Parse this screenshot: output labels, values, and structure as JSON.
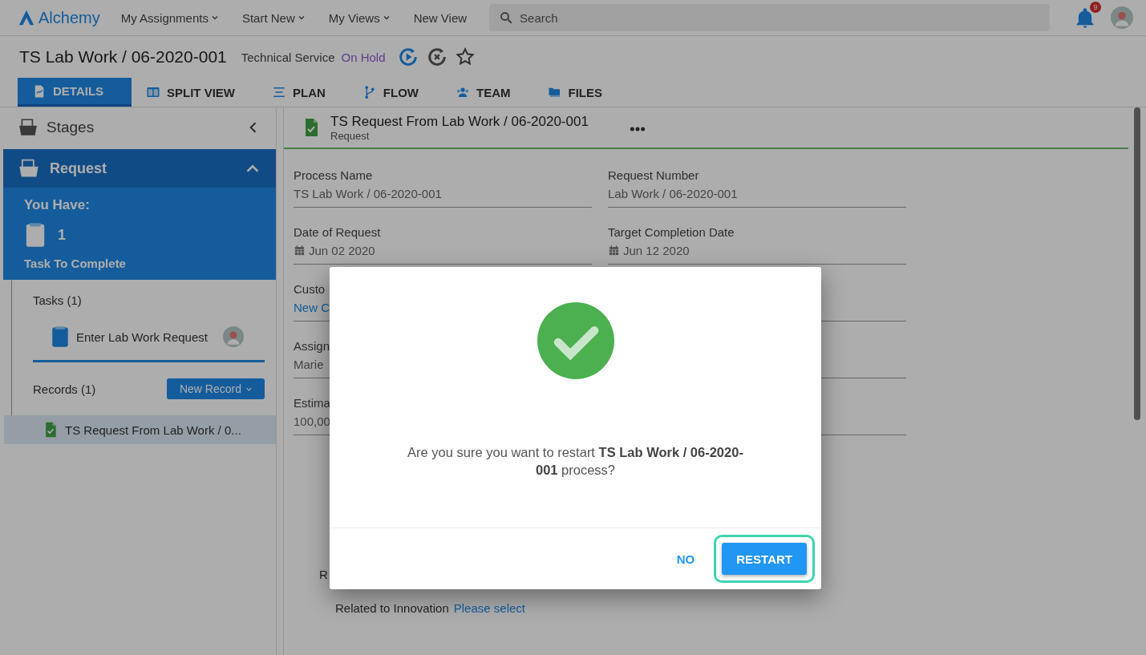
{
  "topbar": {
    "logo": "Alchemy",
    "nav": [
      {
        "label": "My Assignments",
        "dropdown": true
      },
      {
        "label": "Start New",
        "dropdown": true
      },
      {
        "label": "My Views",
        "dropdown": true
      },
      {
        "label": "New View",
        "dropdown": false
      }
    ],
    "search": {
      "placeholder": "Search"
    },
    "notifications": "9"
  },
  "header": {
    "title": "TS Lab Work / 06-2020-001",
    "type": "Technical Service",
    "status": "On Hold"
  },
  "tabs": [
    {
      "label": "DETAILS",
      "selected": true
    },
    {
      "label": "SPLIT VIEW",
      "selected": false
    },
    {
      "label": "PLAN",
      "selected": false
    },
    {
      "label": "FLOW",
      "selected": false
    },
    {
      "label": "TEAM",
      "selected": false
    },
    {
      "label": "FILES",
      "selected": false
    }
  ],
  "sidebar": {
    "heading": "Stages",
    "stage": {
      "name": "Request",
      "expanded": true
    },
    "summary": {
      "heading": "You Have:",
      "count": "1",
      "caption": "Task To Complete"
    },
    "tasks": {
      "heading": "Tasks (1)",
      "items": [
        {
          "label": "Enter Lab Work Request"
        }
      ]
    },
    "records": {
      "heading": "Records (1)",
      "button": "New Record",
      "items": [
        {
          "label": "TS Request From Lab Work / 0...",
          "selected": true
        }
      ]
    }
  },
  "record": {
    "title": "TS Request From Lab Work / 06-2020-001",
    "subtitle": "Request",
    "fields": [
      {
        "label": "Process Name",
        "value": "TS Lab Work / 06-2020-001",
        "kind": "text"
      },
      {
        "label": "Request Number",
        "value": "Lab Work / 06-2020-001",
        "kind": "text"
      },
      {
        "label": "Date of Request",
        "value": "Jun 02 2020",
        "kind": "date"
      },
      {
        "label": "Target Completion Date",
        "value": "Jun 12 2020",
        "kind": "date"
      },
      {
        "label": "Custo",
        "value": "New C",
        "kind": "link"
      },
      {
        "kind": "hidden"
      },
      {
        "label": "Assign",
        "value": "Marie",
        "kind": "text"
      },
      {
        "kind": "hidden"
      },
      {
        "label": "Estima",
        "value": "100,00",
        "kind": "text"
      },
      {
        "kind": "hidden"
      }
    ],
    "lower": [
      {
        "label": "R"
      },
      {
        "label": "Related to Innovation",
        "value": "Please select"
      }
    ]
  },
  "dialog": {
    "message": "Are you sure you want to restart **TS Lab Work / 06-2020-001** process?",
    "buttons": [
      {
        "label": "NO",
        "kind": "text",
        "highlighted": false
      },
      {
        "label": "RESTART",
        "kind": "primary",
        "highlighted": true
      }
    ]
  }
}
